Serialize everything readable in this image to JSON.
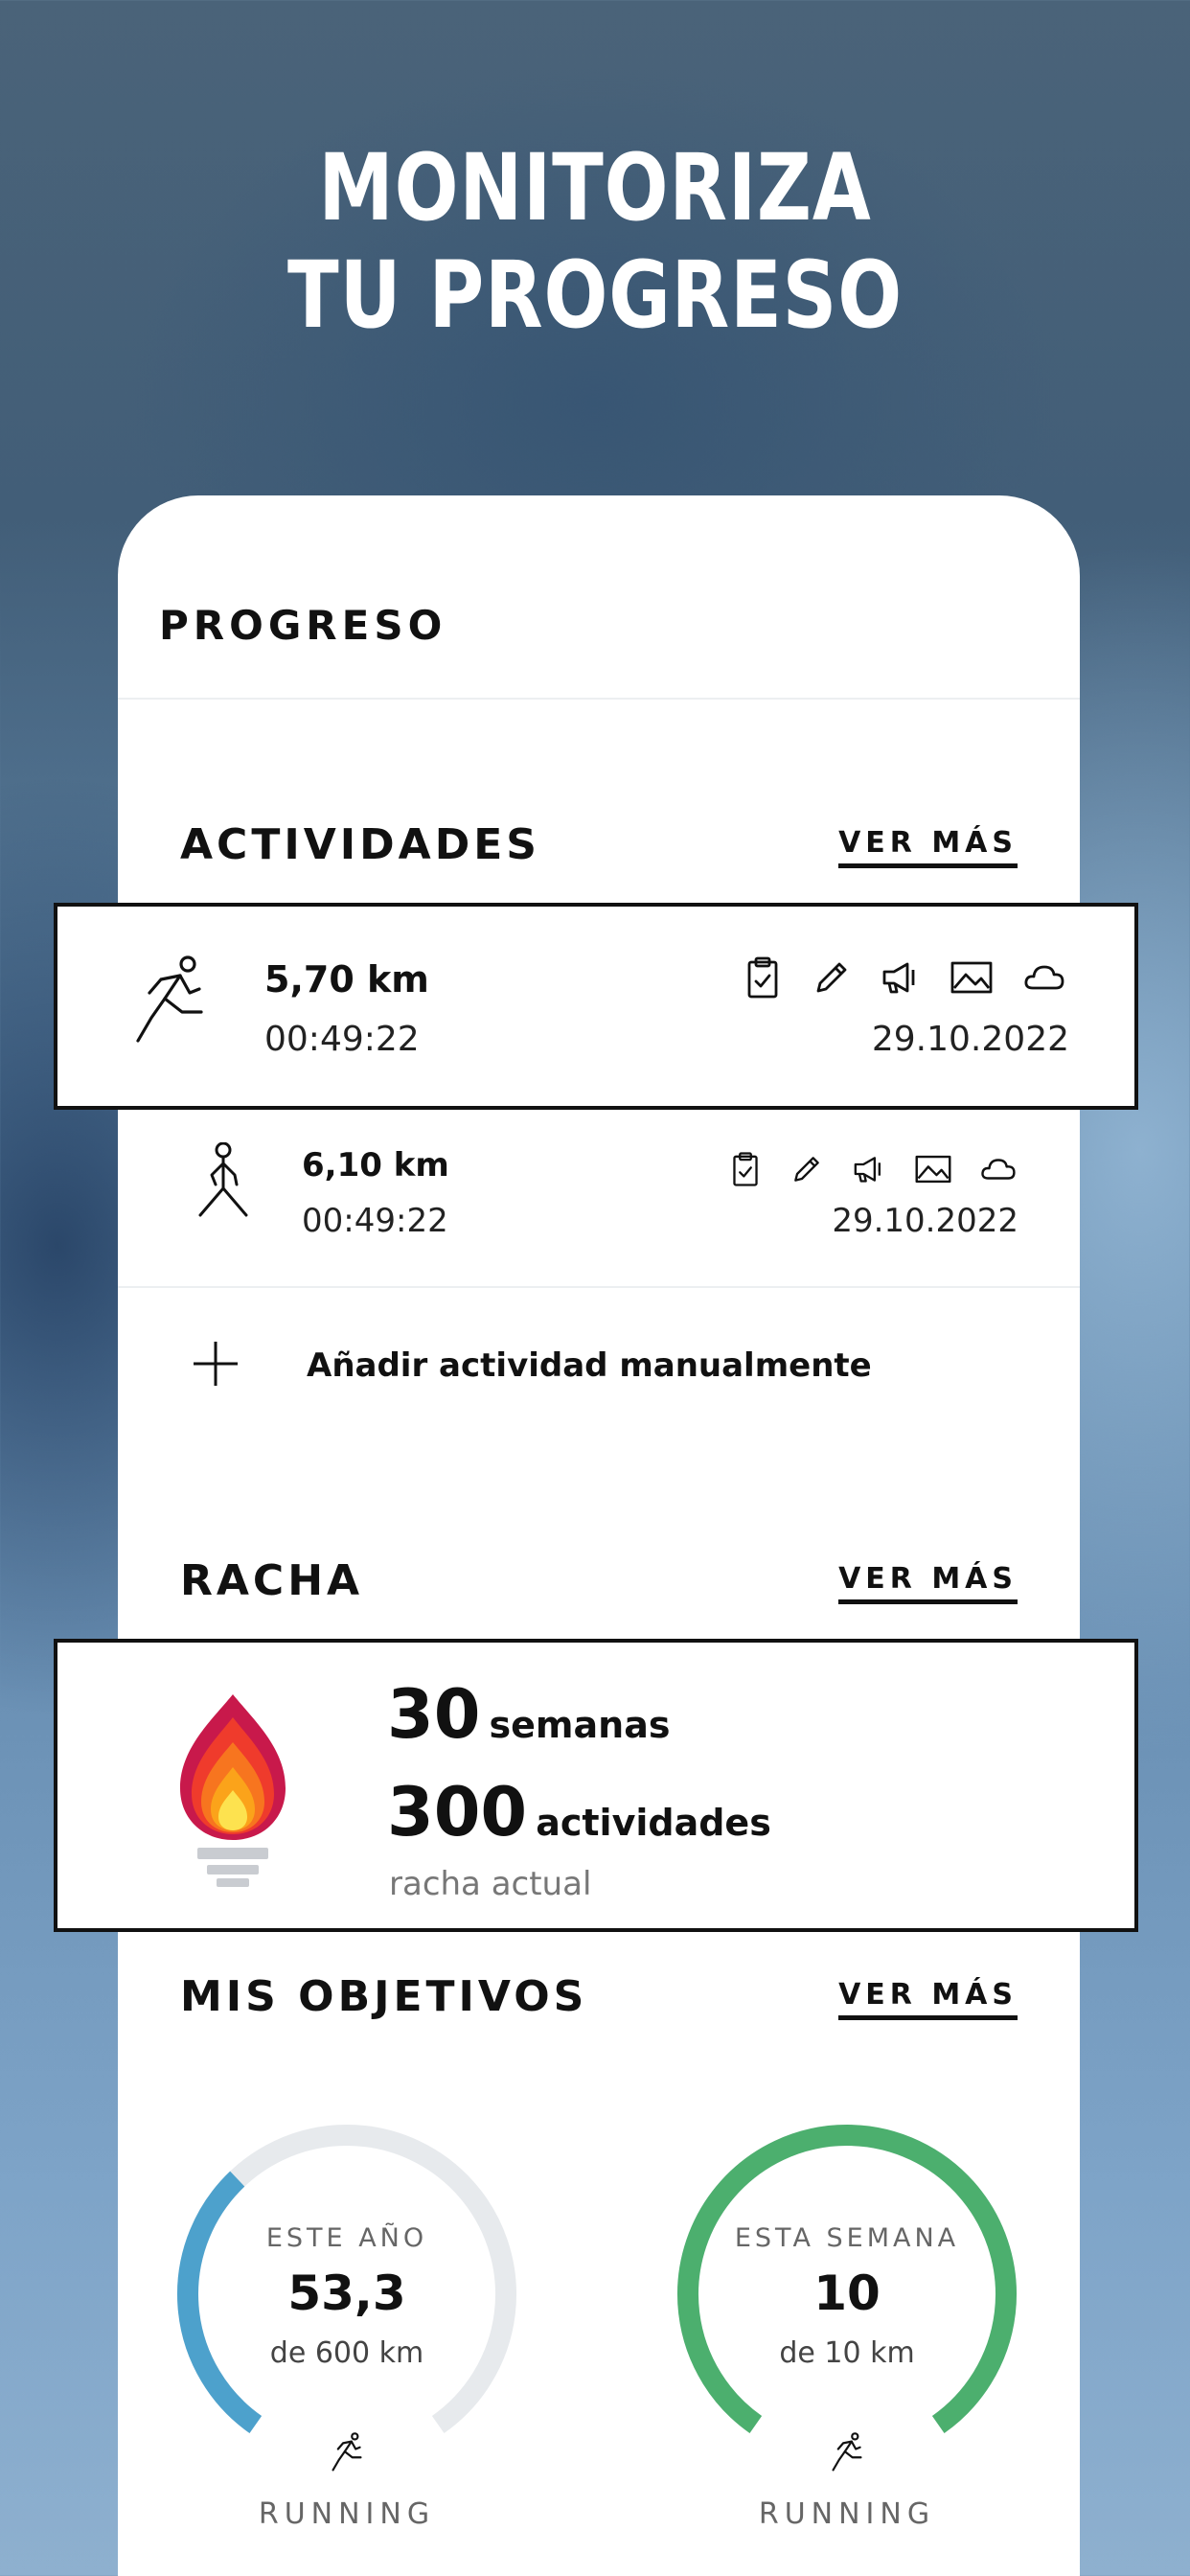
{
  "headline": {
    "line1": "MONITORIZA",
    "line2": "TU PROGRESO"
  },
  "card": {
    "title": "PROGRESO"
  },
  "activities": {
    "title": "ACTIVIDADES",
    "more": "VER MÁS",
    "items": [
      {
        "type_icon": "running-person-icon",
        "distance": "5,70 km",
        "duration": "00:49:22",
        "date": "29.10.2022"
      },
      {
        "type_icon": "walking-person-icon",
        "distance": "6,10 km",
        "duration": "00:49:22",
        "date": "29.10.2022"
      }
    ],
    "tools": [
      "clipboard-check-icon",
      "pencil-icon",
      "megaphone-icon",
      "image-icon",
      "cloud-icon"
    ],
    "add_label": "Añadir actividad manualmente"
  },
  "streak": {
    "title": "RACHA",
    "more": "VER MÁS",
    "weeks_value": "30",
    "weeks_unit": "semanas",
    "activities_value": "300",
    "activities_unit": "actividades",
    "caption": "racha actual",
    "colors": {
      "outer": "#c8194b",
      "mid1": "#ef3b2c",
      "mid2": "#f7751f",
      "mid3": "#fba31a",
      "core": "#fde24f",
      "base": "#c9ccd1"
    }
  },
  "goals": {
    "title": "MIS OBJETIVOS",
    "more": "VER MÁS",
    "items": [
      {
        "period": "ESTE AÑO",
        "value": "53,3",
        "target": "de 600 km",
        "sport": "RUNNING",
        "progress": 0.35,
        "color": "#4da1cc"
      },
      {
        "period": "ESTA SEMANA",
        "value": "10",
        "target": "de 10 km",
        "sport": "RUNNING",
        "progress": 1.0,
        "color": "#4caf6e"
      }
    ],
    "track_color": "#e7eaed"
  }
}
